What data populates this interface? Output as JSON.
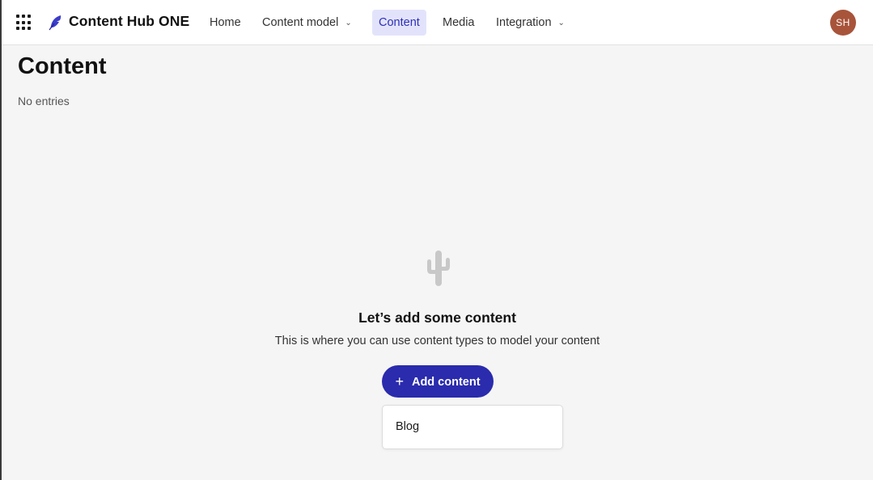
{
  "app": {
    "brand": "Content Hub ONE",
    "user_initials": "SH",
    "accent_color": "#2a2bad",
    "avatar_color": "#a8543a"
  },
  "nav": {
    "home": "Home",
    "content_model": "Content model",
    "content": "Content",
    "media": "Media",
    "integration": "Integration",
    "active": "Content"
  },
  "page": {
    "title": "Content",
    "entries_status": "No entries"
  },
  "empty_state": {
    "icon": "cactus-icon",
    "title": "Let’s add some content",
    "description": "This is where you can use content types to model your content",
    "add_button_label": "Add content"
  },
  "dropdown": {
    "items": [
      {
        "label": "Blog"
      }
    ]
  }
}
